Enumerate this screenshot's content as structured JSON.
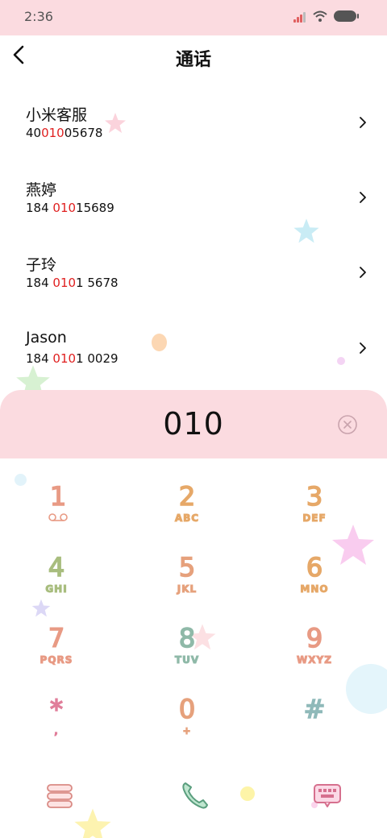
{
  "status_bar": {
    "time": "2:36"
  },
  "header": {
    "title": "通话"
  },
  "contacts": [
    {
      "name": "小米客服",
      "number_parts": [
        "40",
        "010",
        "05678"
      ]
    },
    {
      "name": "燕婷",
      "number_parts": [
        "184 ",
        "010",
        "15689"
      ]
    },
    {
      "name": "子玲",
      "number_parts": [
        "184 ",
        "010",
        "1 5678"
      ]
    },
    {
      "name": "Jason",
      "number_parts": [
        "184 ",
        "010",
        "1 0029"
      ]
    }
  ],
  "dialer": {
    "number": "010",
    "keys": [
      {
        "digit": "1",
        "letters": "",
        "color": "#e89a84"
      },
      {
        "digit": "2",
        "letters": "ABC",
        "color": "#e6a868"
      },
      {
        "digit": "3",
        "letters": "DEF",
        "color": "#e6a868"
      },
      {
        "digit": "4",
        "letters": "GHI",
        "color": "#a8bd7e"
      },
      {
        "digit": "5",
        "letters": "JKL",
        "color": "#e6a17c"
      },
      {
        "digit": "6",
        "letters": "MNO",
        "color": "#e6a868"
      },
      {
        "digit": "7",
        "letters": "PQRS",
        "color": "#e89a84"
      },
      {
        "digit": "8",
        "letters": "TUV",
        "color": "#8fb9a8"
      },
      {
        "digit": "9",
        "letters": "WXYZ",
        "color": "#e89a84"
      },
      {
        "digit": "*",
        "letters": ",",
        "color": "#e07e9a"
      },
      {
        "digit": "0",
        "letters": "+",
        "color": "#e6a17c"
      },
      {
        "digit": "#",
        "letters": "",
        "color": "#8fb9b9"
      }
    ]
  },
  "colors": {
    "accent_pink": "#fbdbe0",
    "highlight_red": "#e02020"
  },
  "icons": {
    "back": "back-arrow-icon",
    "chevron": "chevron-right-icon",
    "delete": "delete-icon",
    "menu": "menu-icon",
    "call": "phone-call-icon",
    "keyboard": "keyboard-icon"
  }
}
